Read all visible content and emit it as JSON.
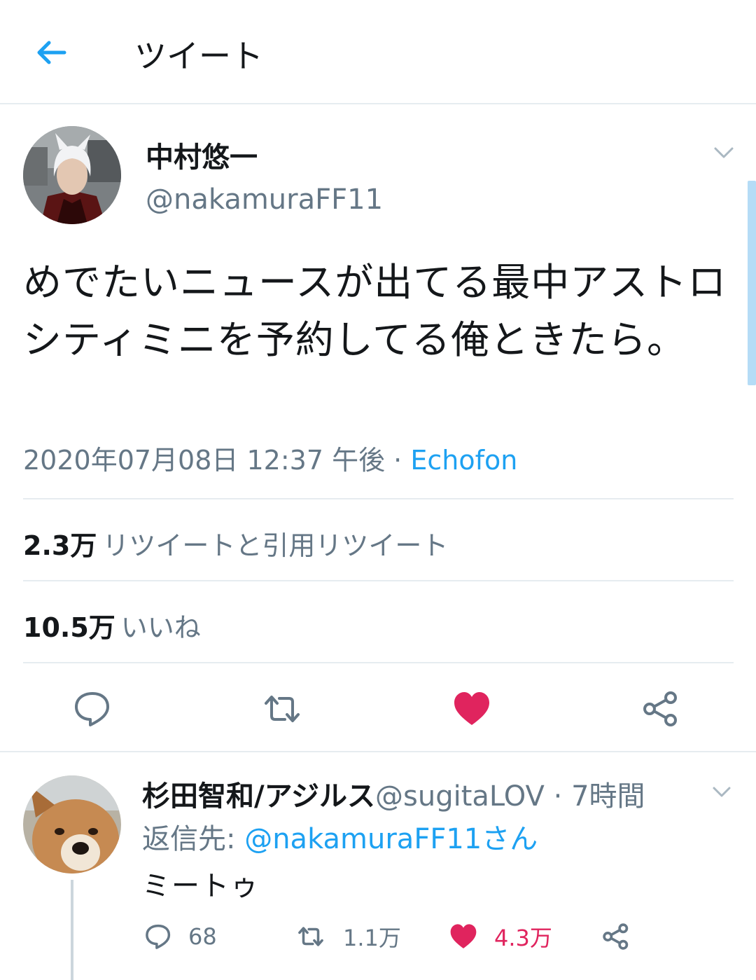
{
  "header": {
    "title": "ツイート"
  },
  "tweet": {
    "name": "中村悠一",
    "handle": "@nakamuraFF11",
    "text": "めでたいニュースが出てる最中アストロシティミニを予約してる俺ときたら。",
    "timestamp": "2020年07月08日 12:37 午後",
    "separator": " · ",
    "source": "Echofon",
    "retweets_count": "2.3万",
    "retweets_label": "リツイートと引用リツイート",
    "likes_count": "10.5万",
    "likes_label": "いいね",
    "liked": true
  },
  "reply": {
    "name": "杉田智和/アジルス",
    "handle": "@sugitaLOV",
    "time": " · 7時間",
    "reply_to_label": "返信先: ",
    "reply_to_user": "@nakamuraFF11さん",
    "text": "ミートゥ",
    "replies": "68",
    "retweets": "1.1万",
    "likes": "4.3万",
    "liked": true
  },
  "colors": {
    "accent": "#1da1f2",
    "like": "#e0245e",
    "secondary_text": "#657786",
    "divider": "#e6ecf0"
  },
  "icons": {
    "back": "arrow-left-icon",
    "menu": "chevron-down-icon",
    "reply": "speech-bubble-icon",
    "retweet": "retweet-icon",
    "like": "heart-icon",
    "share": "share-icon"
  }
}
